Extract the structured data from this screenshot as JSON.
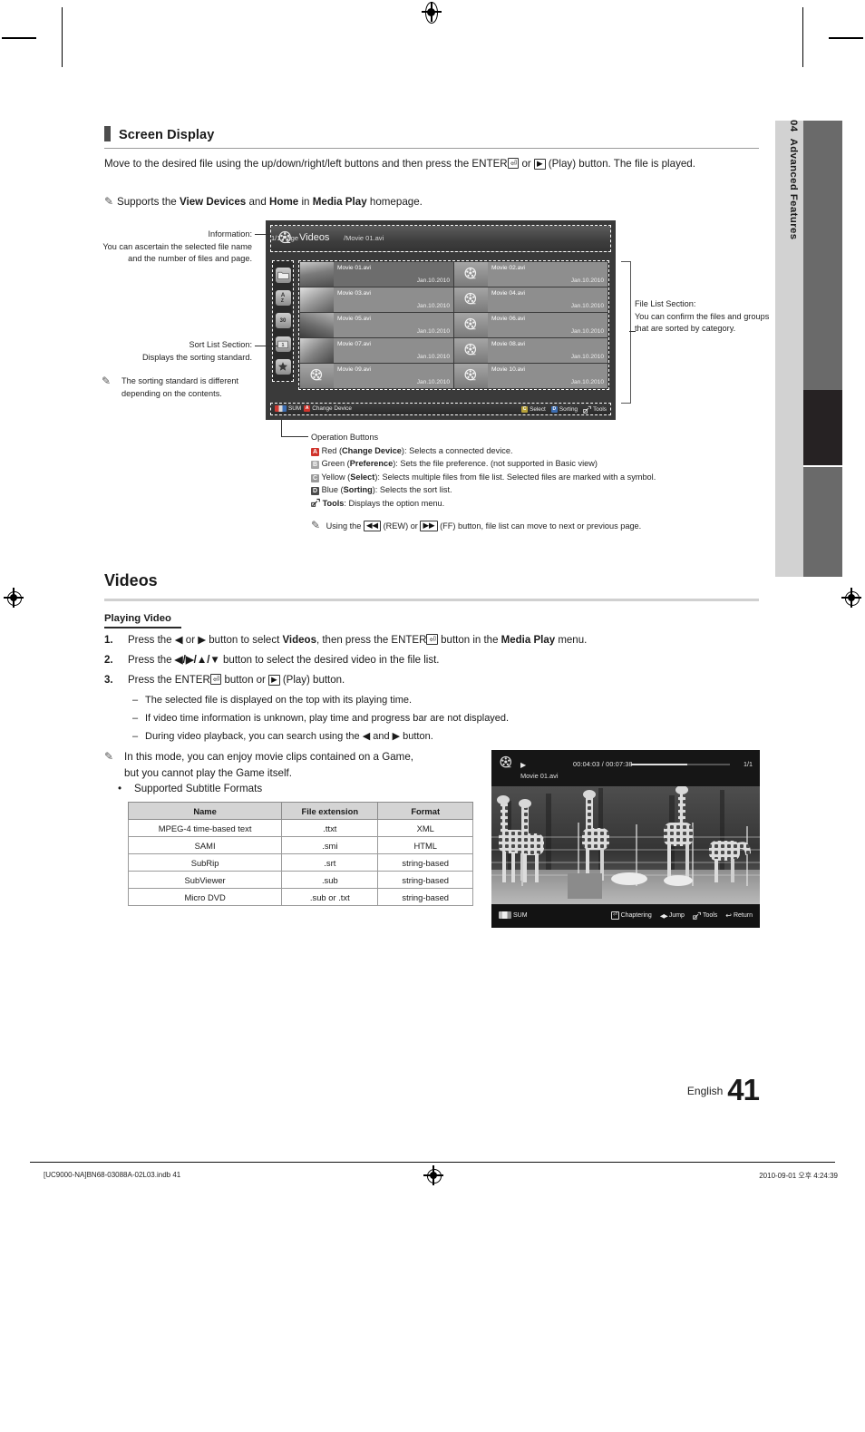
{
  "chapter": {
    "number": "04",
    "title": "Advanced Features"
  },
  "section": {
    "heading": "Screen Display",
    "intro_1": "Move to the desired file using the up/down/right/left buttons and then press the ENTER",
    "intro_1b": "or",
    "intro_1c": "(Play) button. The file is played.",
    "note_1_a": "Supports the ",
    "note_1_b": "View Devices",
    "note_1_c": " and ",
    "note_1_d": "Home",
    "note_1_e": " in ",
    "note_1_f": "Media Play",
    "note_1_g": " homepage."
  },
  "callouts": {
    "information_title": "Information:",
    "information_body": "You can ascertain the selected file name and the number of files and page.",
    "sort_title": "Sort List Section:",
    "sort_body": "Displays the sorting standard.",
    "sort_note": "The sorting standard is different depending on the contents.",
    "filelist_title": "File List Section:",
    "filelist_body": "You can confirm the files and groups that are sorted by category."
  },
  "operation": {
    "title": "Operation Buttons",
    "items": [
      {
        "key": "A",
        "color": "#d0342c",
        "label": "Red",
        "bold": "Change Device",
        "desc": "Selects a connected device."
      },
      {
        "key": "B",
        "color": "#9a9a9a",
        "label": "Green",
        "bold": "Preference",
        "desc": "Sets the file preference. (not supported in Basic view)"
      },
      {
        "key": "C",
        "color": "#9a9a9a",
        "label": "Yellow",
        "bold": "Select",
        "desc": "Selects multiple files from file list. Selected files are marked with a symbol."
      },
      {
        "key": "D",
        "color": "#555555",
        "label": "Blue",
        "bold": "Sorting",
        "desc": "Selects the sort list."
      }
    ],
    "tools_bold": "Tools",
    "tools_desc": ": Displays the option menu.",
    "note_a": "Using the",
    "note_rew": "(REW) or",
    "note_ff": "(FF) button, file list can move to next or previous page."
  },
  "tv_filelist": {
    "title": "Videos",
    "path": "/Movie 01.avi",
    "page": "1/1 Page",
    "sort_icons": [
      "folder-icon",
      "alphabet-az-icon",
      "calendar-30-icon",
      "preference-icon",
      "favorites-star-icon"
    ],
    "files": [
      {
        "name": "Movie 01.avi",
        "date": "Jan.10.2010",
        "thumb": "photo",
        "selected": true
      },
      {
        "name": "Movie 02.avi",
        "date": "Jan.10.2010",
        "thumb": "reel",
        "selected": false
      },
      {
        "name": "Movie 03.avi",
        "date": "Jan.10.2010",
        "thumb": "photo",
        "selected": false
      },
      {
        "name": "Movie 04.avi",
        "date": "Jan.10.2010",
        "thumb": "reel",
        "selected": false
      },
      {
        "name": "Movie 05.avi",
        "date": "Jan.10.2010",
        "thumb": "photo",
        "selected": false
      },
      {
        "name": "Movie 06.avi",
        "date": "Jan.10.2010",
        "thumb": "reel",
        "selected": false
      },
      {
        "name": "Movie 07.avi",
        "date": "Jan.10.2010",
        "thumb": "photo",
        "selected": false
      },
      {
        "name": "Movie 08.avi",
        "date": "Jan.10.2010",
        "thumb": "reel",
        "selected": false
      },
      {
        "name": "Movie 09.avi",
        "date": "Jan.10.2010",
        "thumb": "reel",
        "selected": false
      },
      {
        "name": "Movie 10.avi",
        "date": "Jan.10.2010",
        "thumb": "reel",
        "selected": false
      }
    ],
    "bottom_left": [
      {
        "icon": "sum-icon",
        "label": "SUM"
      },
      {
        "icon": "a-button-icon",
        "label": "Change Device",
        "key": "A",
        "color": "#d0342c"
      }
    ],
    "bottom_right": [
      {
        "key": "C",
        "color": "#c9b23a",
        "label": "Select"
      },
      {
        "key": "D",
        "color": "#3d6fb5",
        "label": "Sorting"
      },
      {
        "key": "T",
        "color": "",
        "label": "Tools"
      }
    ]
  },
  "videos": {
    "heading": "Videos",
    "sub_heading": "Playing Video",
    "steps": [
      {
        "num": "1.",
        "parts": [
          "Press the ",
          "◀",
          " or ",
          "▶",
          " button to select ",
          "Videos",
          ", then press the ENTER",
          " button in the ",
          "Media Play",
          " menu."
        ]
      },
      {
        "num": "2.",
        "text_a": "Press the ",
        "keys": "◀/▶/▲/▼",
        "text_b": " button to select the desired video in the file list."
      },
      {
        "num": "3.",
        "text_a": "Press the ENTER",
        "text_b": " button or ",
        "text_c": " (Play) button."
      }
    ],
    "dashes": [
      "The selected file is displayed on the top with its playing time.",
      "If video time information is unknown, play time and progress bar are not displayed.",
      "During video playback, you can search using the ◀ and ▶ button."
    ],
    "game_note_line1": "In this mode, you can enjoy movie clips contained on a Game,",
    "game_note_line2": "but you cannot play the Game itself.",
    "bullet_subtitle": "Supported Subtitle Formats"
  },
  "subtitle_table": {
    "headers": [
      "Name",
      "File extension",
      "Format"
    ],
    "rows": [
      [
        "MPEG-4 time-based text",
        ".ttxt",
        "XML"
      ],
      [
        "SAMI",
        ".smi",
        "HTML"
      ],
      [
        "SubRip",
        ".srt",
        "string-based"
      ],
      [
        "SubViewer",
        ".sub",
        "string-based"
      ],
      [
        "Micro DVD",
        ".sub or .txt",
        "string-based"
      ]
    ]
  },
  "tv_player": {
    "time": "00:04:03 / 00:07:38",
    "page": "1/1",
    "filename": "Movie 01.avi",
    "progress_percent": 57,
    "bottom_left_label": "SUM",
    "bottom_right": [
      {
        "icon": "enter-icon",
        "label": "Chaptering"
      },
      {
        "icon": "left-right-icon",
        "label": "Jump"
      },
      {
        "icon": "tools-icon",
        "label": "Tools"
      },
      {
        "icon": "return-icon",
        "label": "Return"
      }
    ]
  },
  "footer": {
    "language": "English",
    "page_number": "41",
    "file_ref": "[UC9000-NA]BN68-03088A-02L03.indb   41",
    "timestamp": "2010-09-01   오후 4:24:39"
  }
}
